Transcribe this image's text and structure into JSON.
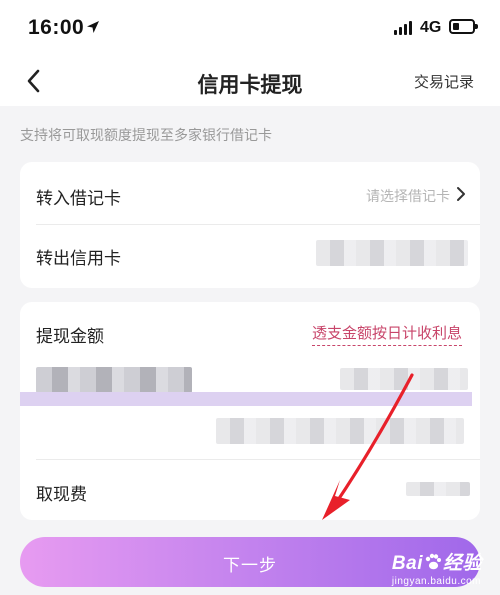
{
  "status_bar": {
    "time": "16:00",
    "network": "4G"
  },
  "nav": {
    "title": "信用卡提现",
    "right_action": "交易记录"
  },
  "hint": "支持将可取现额度提现至多家银行借记卡",
  "transfer_card": {
    "debit_label": "转入借记卡",
    "debit_placeholder": "请选择借记卡",
    "credit_label": "转出信用卡"
  },
  "amount_card": {
    "amount_label": "提现金额",
    "interest_link": "透支金额按日计收利息",
    "fee_label": "取现费"
  },
  "next_button": {
    "label": "下一步"
  },
  "watermark": {
    "brand_a": "Bai",
    "brand_b": "经验",
    "sub": "jingyan.baidu.com"
  },
  "colors": {
    "accent_red": "#c8456a",
    "button_start": "#e79bf1",
    "button_end": "#a068ea",
    "arrow": "#e8202a"
  }
}
